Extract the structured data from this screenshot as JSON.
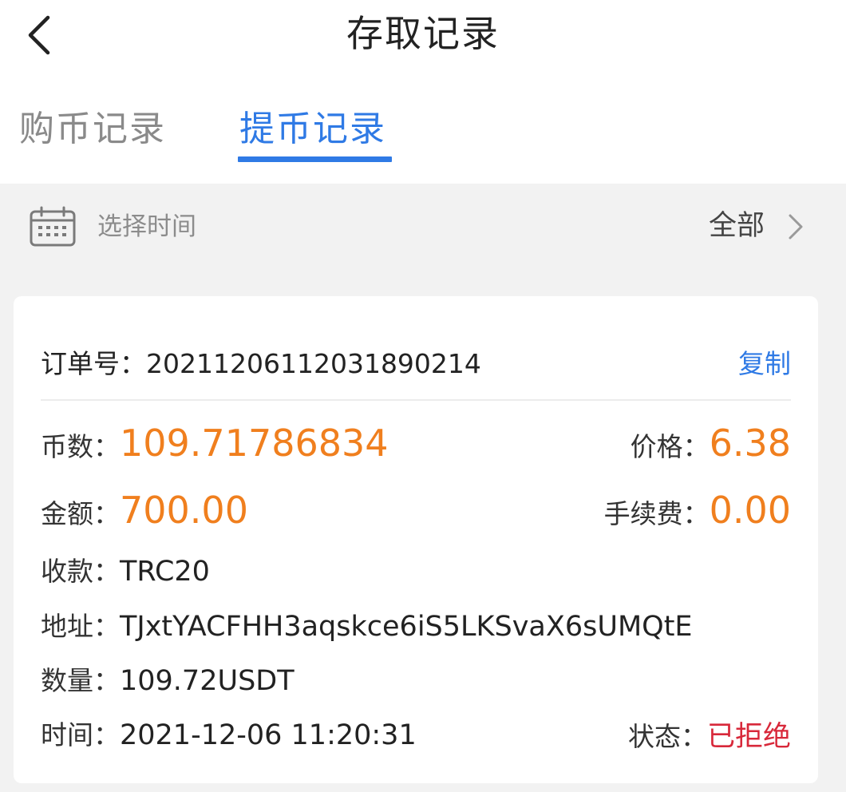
{
  "header": {
    "title": "存取记录",
    "back_icon": "chevron-left-icon"
  },
  "tabs": [
    {
      "label": "购币记录",
      "active": false
    },
    {
      "label": "提币记录",
      "active": true
    }
  ],
  "filter": {
    "time_label": "选择时间",
    "status_value": "全部",
    "calendar_icon": "calendar-icon",
    "chevron_icon": "chevron-right-icon"
  },
  "record": {
    "order_label": "订单号：",
    "order_no": "20211206112031890214",
    "copy_label": "复制",
    "coins_label": "币数：",
    "coins_value": "109.71786834",
    "price_label": "价格：",
    "price_value": "6.38",
    "amount_label": "金额：",
    "amount_value": "700.00",
    "fee_label": "手续费：",
    "fee_value": "0.00",
    "receive_label": "收款：",
    "receive_value": "TRC20",
    "address_label": "地址：",
    "address_value": "TJxtYACFHH3aqskce6iS5LKSvaX6sUMQtE",
    "qty_label": "数量：",
    "qty_value": "109.72USDT",
    "time_label": "时间：",
    "time_value": "2021-12-06 11:20:31",
    "status_label": "状态：",
    "status_value": "已拒绝"
  },
  "colors": {
    "accent_blue": "#2f7ae5",
    "value_orange": "#f07f1e",
    "status_red": "#d8283a",
    "background": "#f2f2f2"
  }
}
